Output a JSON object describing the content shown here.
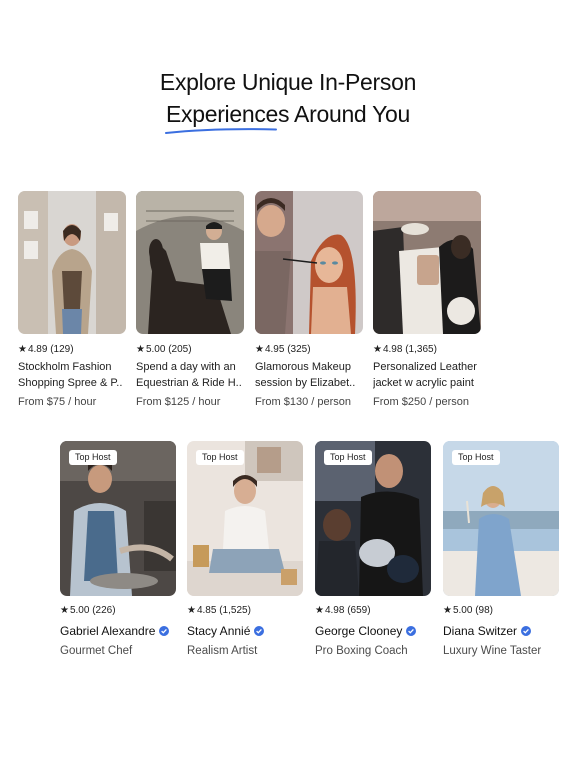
{
  "hero": {
    "line1": "Explore Unique In-Person",
    "line2": "Experiences Around You",
    "accent": "#3b6fe0"
  },
  "experiences": [
    {
      "rating": "4.89 (129)",
      "title_line1": "Stockholm Fashion",
      "title_line2": "Shopping Spree & P..",
      "price": "From $75 / hour"
    },
    {
      "rating": "5.00 (205)",
      "title_line1": "Spend a day with an",
      "title_line2": "Equestrian & Ride H..",
      "price": "From $125 / hour"
    },
    {
      "rating": "4.95 (325)",
      "title_line1": "Glamorous Makeup",
      "title_line2": "session by Elizabet..",
      "price": "From $130 / person"
    },
    {
      "rating": "4.98 (1,365)",
      "title_line1": "Personalized Leather",
      "title_line2": "jacket w acrylic paint",
      "price": "From $250 / person"
    }
  ],
  "hosts": [
    {
      "badge": "Top Host",
      "rating": "5.00 (226)",
      "name": "Gabriel Alexandre",
      "role": "Gourmet Chef"
    },
    {
      "badge": "Top Host",
      "rating": "4.85 (1,525)",
      "name": "Stacy Annié",
      "role": "Realism Artist"
    },
    {
      "badge": "Top Host",
      "rating": "4.98 (659)",
      "name": "George Clooney",
      "role": "Pro Boxing Coach"
    },
    {
      "badge": "Top Host",
      "rating": "5.00 (98)",
      "name": "Diana Switzer",
      "role": "Luxury Wine Taster"
    }
  ],
  "icons": {
    "star": "★",
    "verified": "verified-badge-icon"
  }
}
